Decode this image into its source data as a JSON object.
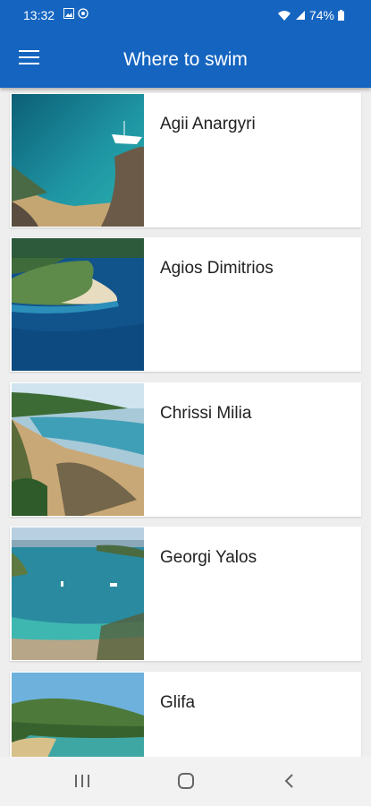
{
  "status": {
    "time": "13:32",
    "battery": "74%"
  },
  "app_bar": {
    "title": "Where to swim",
    "menu_icon": "hamburger-menu-icon"
  },
  "beaches": [
    {
      "name": "Agii Anargyri"
    },
    {
      "name": "Agios Dimitrios"
    },
    {
      "name": "Chrissi Milia"
    },
    {
      "name": "Georgi Yalos"
    },
    {
      "name": "Glifa"
    }
  ],
  "nav": {
    "recents_icon": "recents-icon",
    "home_icon": "home-icon",
    "back_icon": "back-icon"
  }
}
